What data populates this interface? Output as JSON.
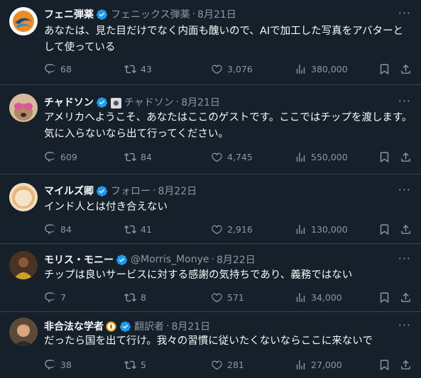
{
  "tweets": [
    {
      "name": "フェニ弾薬",
      "handle": "フェニックス弾薬",
      "date": "8月21日",
      "text": "あなたは、見た目だけでなく内面も醜いので、AIで加工した写真をアバターとして使っている",
      "replies": "68",
      "retweets": "43",
      "likes": "3,076",
      "views": "380,000"
    },
    {
      "name": "チャドソン",
      "handle": "チャドソン",
      "date": "8月21日",
      "text": "アメリカへようこそ、あなたはここのゲストです。ここではチップを渡します。気に入らないなら出て行ってください。",
      "replies": "609",
      "retweets": "84",
      "likes": "4,745",
      "views": "550,000"
    },
    {
      "name": "マイルズ卿",
      "handle": "フォロー",
      "date": "8月22日",
      "text": "インド人とは付き合えない",
      "replies": "84",
      "retweets": "41",
      "likes": "2,916",
      "views": "130,000"
    },
    {
      "name": "モリス・モニー",
      "handle": "@Morris_Monye",
      "date": "8月22日",
      "text": "チップは良いサービスに対する感謝の気持ちであり、義務ではない",
      "replies": "7",
      "retweets": "8",
      "likes": "571",
      "views": "34,000"
    },
    {
      "name": "非合法な学者",
      "handle": "翻訳者",
      "date": "8月21日",
      "text": "だったら国を出て行け。我々の習慣に従いたくないならここに来ないで",
      "replies": "38",
      "retweets": "5",
      "likes": "281",
      "views": "27,000"
    }
  ],
  "ui": {
    "separator": "·",
    "more": "···"
  },
  "colors": {
    "background": "#15202b",
    "muted": "#8b98a5",
    "verified": "#1d9bf0",
    "divider": "#38444d"
  }
}
